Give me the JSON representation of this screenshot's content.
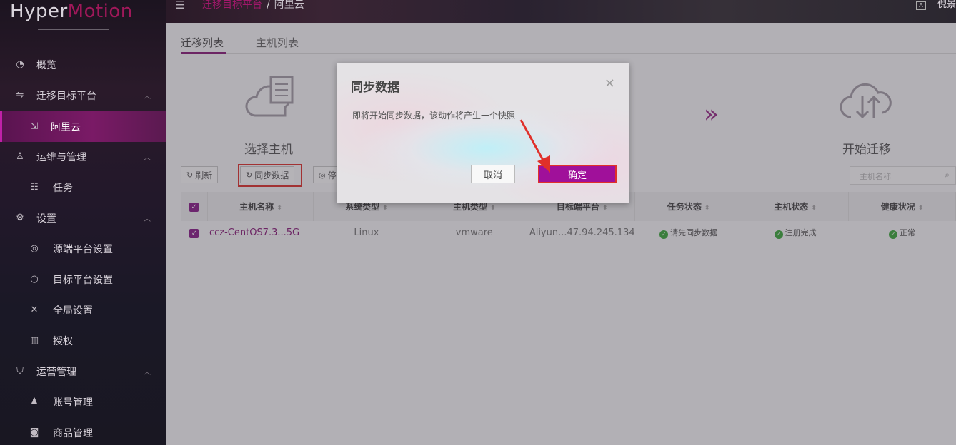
{
  "logo": {
    "part1": "Hyper",
    "part2": "Motion"
  },
  "sidebar": {
    "items": [
      {
        "icon": "dashboard-icon",
        "label": "概览"
      },
      {
        "icon": "swap-icon",
        "label": "迁移目标平台"
      },
      {
        "icon": "cloud-login-icon",
        "label": "阿里云"
      },
      {
        "icon": "user-icon",
        "label": "运维与管理"
      },
      {
        "icon": "task-icon",
        "label": "任务"
      },
      {
        "icon": "gear-icon",
        "label": "设置"
      },
      {
        "icon": "target-icon",
        "label": "源端平台设置"
      },
      {
        "icon": "circle-icon",
        "label": "目标平台设置"
      },
      {
        "icon": "tools-icon",
        "label": "全局设置"
      },
      {
        "icon": "barcode-icon",
        "label": "授权"
      },
      {
        "icon": "shield-icon",
        "label": "运营管理"
      },
      {
        "icon": "account-icon",
        "label": "账号管理"
      },
      {
        "icon": "product-icon",
        "label": "商品管理"
      }
    ]
  },
  "topbar": {
    "breadcrumb_parent": "迁移目标平台",
    "breadcrumb_sep": "/",
    "breadcrumb_current": "阿里云",
    "language_badge": "A",
    "user_name": "倪景"
  },
  "main": {
    "tabs": [
      {
        "label": "迁移列表"
      },
      {
        "label": "主机列表"
      }
    ],
    "steps": [
      {
        "label": "选择主机"
      },
      {
        "label": "开始迁移"
      }
    ],
    "buttons": {
      "refresh": "刷新",
      "sync": "同步数据",
      "other": "停"
    },
    "search_placeholder": "主机名称",
    "table": {
      "headers": [
        "主机名称",
        "系统类型",
        "主机类型",
        "目标端平台",
        "任务状态",
        "主机状态",
        "健康状况"
      ],
      "rows": [
        {
          "name": "ccz-CentOS7.3...5G",
          "os": "Linux",
          "type": "vmware",
          "target": "Aliyun...47.94.245.134",
          "task_status": "请先同步数据",
          "host_status": "注册完成",
          "health": "正常"
        }
      ]
    }
  },
  "modal": {
    "title": "同步数据",
    "message": "即将开始同步数据，该动作将产生一个快照",
    "cancel": "取消",
    "confirm": "确定"
  },
  "colors": {
    "accent": "#a0109a",
    "highlight": "#e0302a",
    "success": "#3aaa3a"
  }
}
